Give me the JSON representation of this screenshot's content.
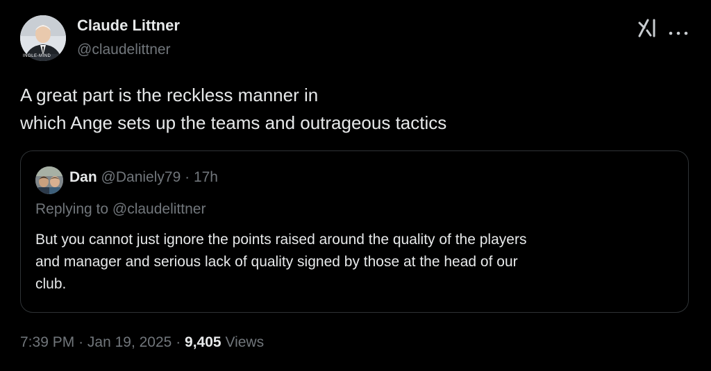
{
  "tweet": {
    "author": {
      "name": "Claude Littner",
      "handle": "@claudelittner",
      "avatar_caption": "INGLE-MIND"
    },
    "text_lines": [
      "A great part is the reckless manner in",
      "which Ange sets up the teams and outrageous tactics"
    ],
    "quoted": {
      "name": "Dan",
      "handle": "@Daniely79",
      "separator": "·",
      "time": "17h",
      "replying_to": "Replying to @claudelittner",
      "text_lines": [
        "But you cannot just ignore the points raised around the quality of the players",
        "and manager and serious lack of quality signed by those at the head of our",
        "club."
      ]
    },
    "footer": {
      "time": "7:39 PM",
      "date": "Jan 19, 2025",
      "separator": "·",
      "views_count": "9,405",
      "views_label": "Views"
    }
  },
  "icons": {
    "grok": "grok-icon",
    "more": "more-icon"
  },
  "colors": {
    "background": "#000000",
    "text_primary": "#e7e9ea",
    "text_secondary": "#71767b",
    "border": "#2f3336"
  }
}
